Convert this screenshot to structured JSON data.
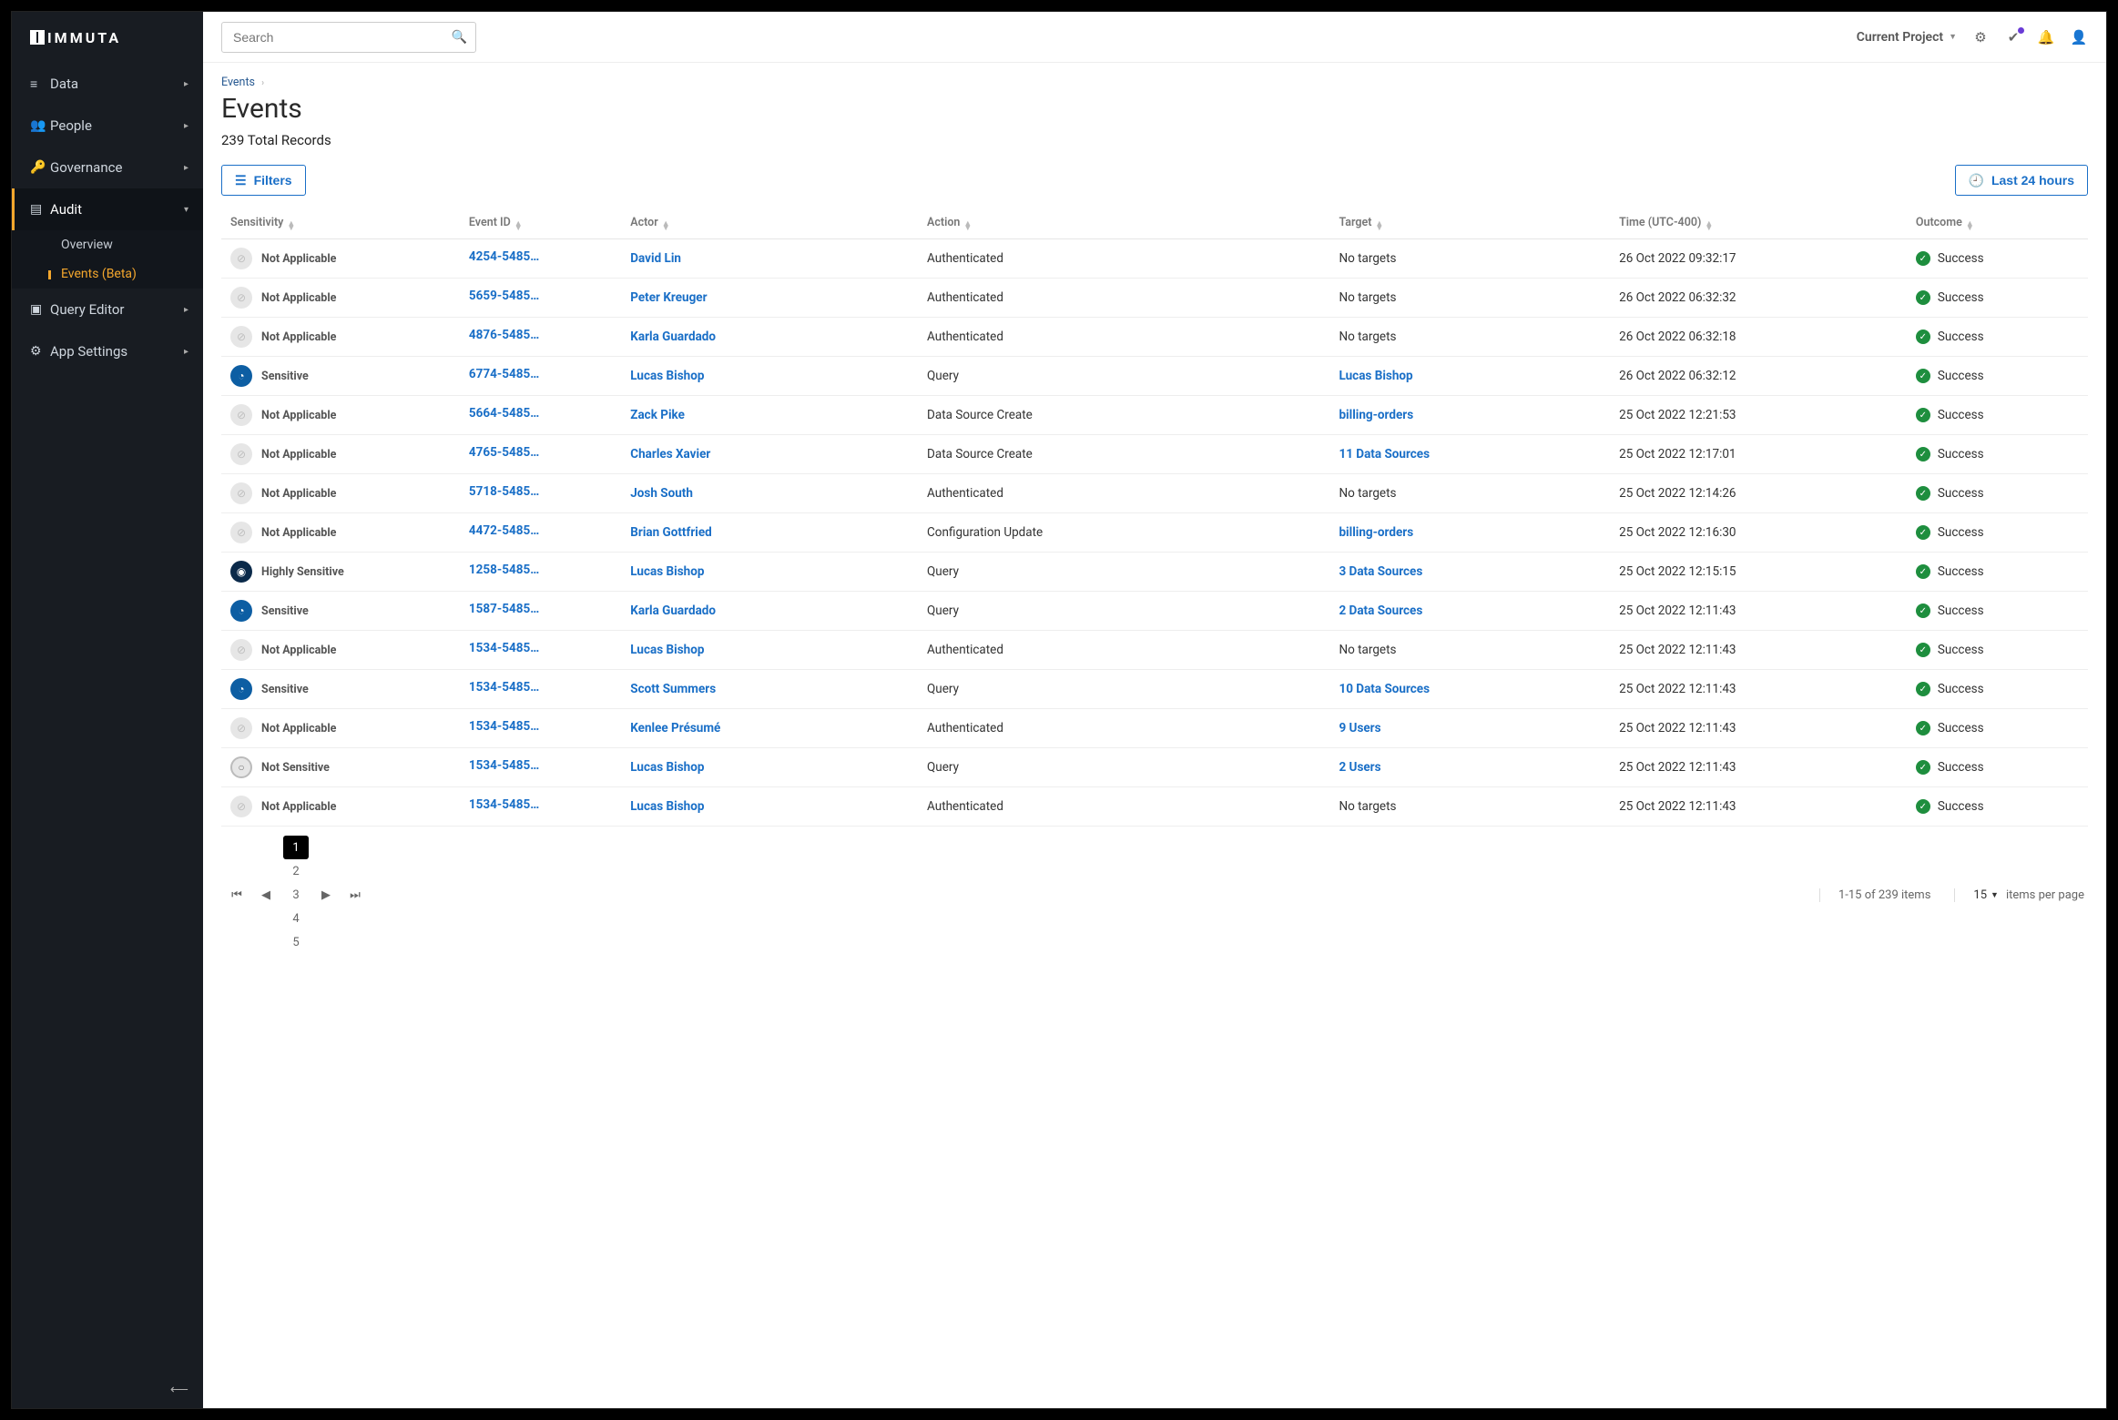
{
  "brand": "IMMUTA",
  "sidebar": {
    "items": [
      {
        "icon": "database-icon",
        "glyph": "≡",
        "label": "Data",
        "active": false,
        "sub": []
      },
      {
        "icon": "people-icon",
        "glyph": "👥",
        "label": "People",
        "active": false,
        "sub": []
      },
      {
        "icon": "key-icon",
        "glyph": "🔑",
        "label": "Governance",
        "active": false,
        "sub": []
      },
      {
        "icon": "audit-icon",
        "glyph": "▤",
        "label": "Audit",
        "active": true,
        "expanded": true,
        "sub": [
          {
            "label": "Overview",
            "active": false
          },
          {
            "label": "Events (Beta)",
            "active": true
          }
        ]
      },
      {
        "icon": "terminal-icon",
        "glyph": "▣",
        "label": "Query Editor",
        "active": false,
        "sub": []
      },
      {
        "icon": "gear-icon",
        "glyph": "⚙",
        "label": "App Settings",
        "active": false,
        "sub": []
      }
    ]
  },
  "topbar": {
    "search_placeholder": "Search",
    "project_label": "Current Project"
  },
  "page": {
    "breadcrumb": "Events",
    "title": "Events",
    "subcount": "239 Total Records",
    "filters_label": "Filters",
    "timerange_label": "Last 24 hours"
  },
  "table": {
    "columns": [
      "Sensitivity",
      "Event ID",
      "Actor",
      "Action",
      "Target",
      "Time (UTC-400)",
      "Outcome"
    ],
    "rows": [
      {
        "sensitivity": "Not Applicable",
        "sens_class": "na",
        "event_id": "4254-5485...",
        "actor": "David Lin",
        "action": "Authenticated",
        "target": "No targets",
        "target_link": false,
        "time": "26 Oct 2022 09:32:17",
        "outcome": "Success"
      },
      {
        "sensitivity": "Not Applicable",
        "sens_class": "na",
        "event_id": "5659-5485...",
        "actor": "Peter Kreuger",
        "action": "Authenticated",
        "target": "No targets",
        "target_link": false,
        "time": "26 Oct 2022 06:32:32",
        "outcome": "Success"
      },
      {
        "sensitivity": "Not Applicable",
        "sens_class": "na",
        "event_id": "4876-5485...",
        "actor": "Karla Guardado",
        "action": "Authenticated",
        "target": "No targets",
        "target_link": false,
        "time": "26 Oct 2022 06:32:18",
        "outcome": "Success"
      },
      {
        "sensitivity": "Sensitive",
        "sens_class": "sensitive",
        "event_id": "6774-5485...",
        "actor": "Lucas Bishop",
        "action": "Query",
        "target": "Lucas Bishop",
        "target_link": true,
        "time": "26 Oct 2022 06:32:12",
        "outcome": "Success"
      },
      {
        "sensitivity": "Not Applicable",
        "sens_class": "na",
        "event_id": "5664-5485...",
        "actor": "Zack Pike",
        "action": "Data Source Create",
        "target": "billing-orders",
        "target_link": true,
        "time": "25 Oct 2022 12:21:53",
        "outcome": "Success"
      },
      {
        "sensitivity": "Not Applicable",
        "sens_class": "na",
        "event_id": "4765-5485...",
        "actor": "Charles Xavier",
        "action": "Data Source Create",
        "target": "11 Data Sources",
        "target_link": true,
        "time": "25 Oct 2022 12:17:01",
        "outcome": "Success"
      },
      {
        "sensitivity": "Not Applicable",
        "sens_class": "na",
        "event_id": "5718-5485...",
        "actor": "Josh South",
        "action": "Authenticated",
        "target": "No targets",
        "target_link": false,
        "time": "25 Oct 2022 12:14:26",
        "outcome": "Success"
      },
      {
        "sensitivity": "Not Applicable",
        "sens_class": "na",
        "event_id": "4472-5485...",
        "actor": "Brian Gottfried",
        "action": "Configuration Update",
        "target": "billing-orders",
        "target_link": true,
        "time": "25 Oct 2022 12:16:30",
        "outcome": "Success"
      },
      {
        "sensitivity": "Highly Sensitive",
        "sens_class": "high",
        "event_id": "1258-5485...",
        "actor": "Lucas Bishop",
        "action": "Query",
        "target": "3 Data Sources",
        "target_link": true,
        "time": "25 Oct 2022 12:15:15",
        "outcome": "Success"
      },
      {
        "sensitivity": "Sensitive",
        "sens_class": "sensitive",
        "event_id": "1587-5485...",
        "actor": "Karla Guardado",
        "action": "Query",
        "target": "2 Data Sources",
        "target_link": true,
        "time": "25 Oct 2022 12:11:43",
        "outcome": "Success"
      },
      {
        "sensitivity": "Not Applicable",
        "sens_class": "na",
        "event_id": "1534-5485...",
        "actor": "Lucas Bishop",
        "action": "Authenticated",
        "target": "No targets",
        "target_link": false,
        "time": "25 Oct 2022 12:11:43",
        "outcome": "Success"
      },
      {
        "sensitivity": "Sensitive",
        "sens_class": "sensitive",
        "event_id": "1534-5485...",
        "actor": "Scott Summers",
        "action": "Query",
        "target": "10 Data Sources",
        "target_link": true,
        "time": "25 Oct 2022 12:11:43",
        "outcome": "Success"
      },
      {
        "sensitivity": "Not Applicable",
        "sens_class": "na",
        "event_id": "1534-5485...",
        "actor": "Kenlee Présumé",
        "action": "Authenticated",
        "target": "9 Users",
        "target_link": true,
        "time": "25 Oct 2022 12:11:43",
        "outcome": "Success"
      },
      {
        "sensitivity": "Not Sensitive",
        "sens_class": "not",
        "event_id": "1534-5485...",
        "actor": "Lucas Bishop",
        "action": "Query",
        "target": "2 Users",
        "target_link": true,
        "time": "25 Oct 2022 12:11:43",
        "outcome": "Success"
      },
      {
        "sensitivity": "Not Applicable",
        "sens_class": "na",
        "event_id": "1534-5485...",
        "actor": "Lucas Bishop",
        "action": "Authenticated",
        "target": "No targets",
        "target_link": false,
        "time": "25 Oct 2022 12:11:43",
        "outcome": "Success"
      }
    ]
  },
  "pager": {
    "pages": [
      "1",
      "2",
      "3",
      "4",
      "5"
    ],
    "current": "1",
    "range": "1-15 of 239 items",
    "per_page": "15",
    "per_page_label": "items per page"
  }
}
